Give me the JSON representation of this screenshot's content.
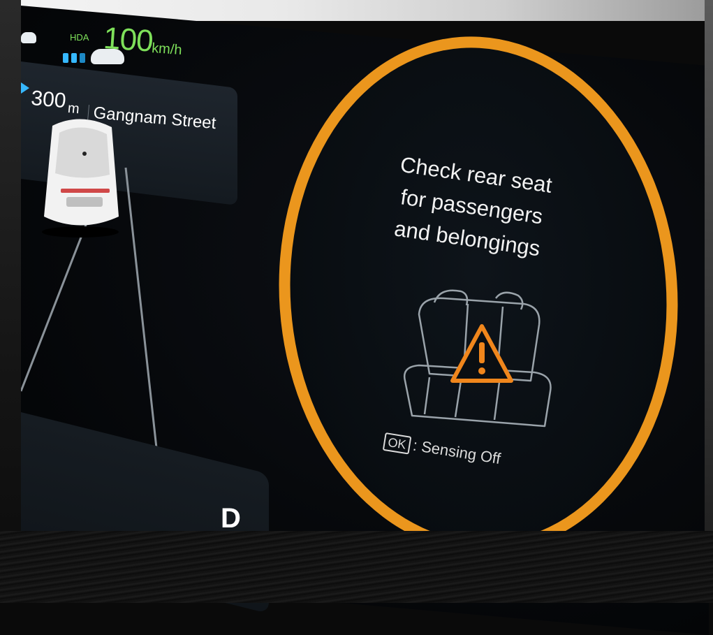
{
  "adas": {
    "hda_label": "HDA",
    "set_speed": "100",
    "speed_unit": "km/h"
  },
  "navigation": {
    "distance": "300",
    "distance_unit": "m",
    "street": "Gangnam Street"
  },
  "drive": {
    "gear": "D"
  },
  "rear_seat_alert": {
    "message_lines": [
      "Check rear seat",
      "for passengers",
      "and belongings"
    ],
    "ok_key": "OK",
    "ok_action": ": Sensing Off"
  },
  "colors": {
    "alert_ring": "#eb961d",
    "hda_green": "#7ee05a",
    "lane_blue": "#36b8ff",
    "warning_orange": "#f0861c"
  }
}
